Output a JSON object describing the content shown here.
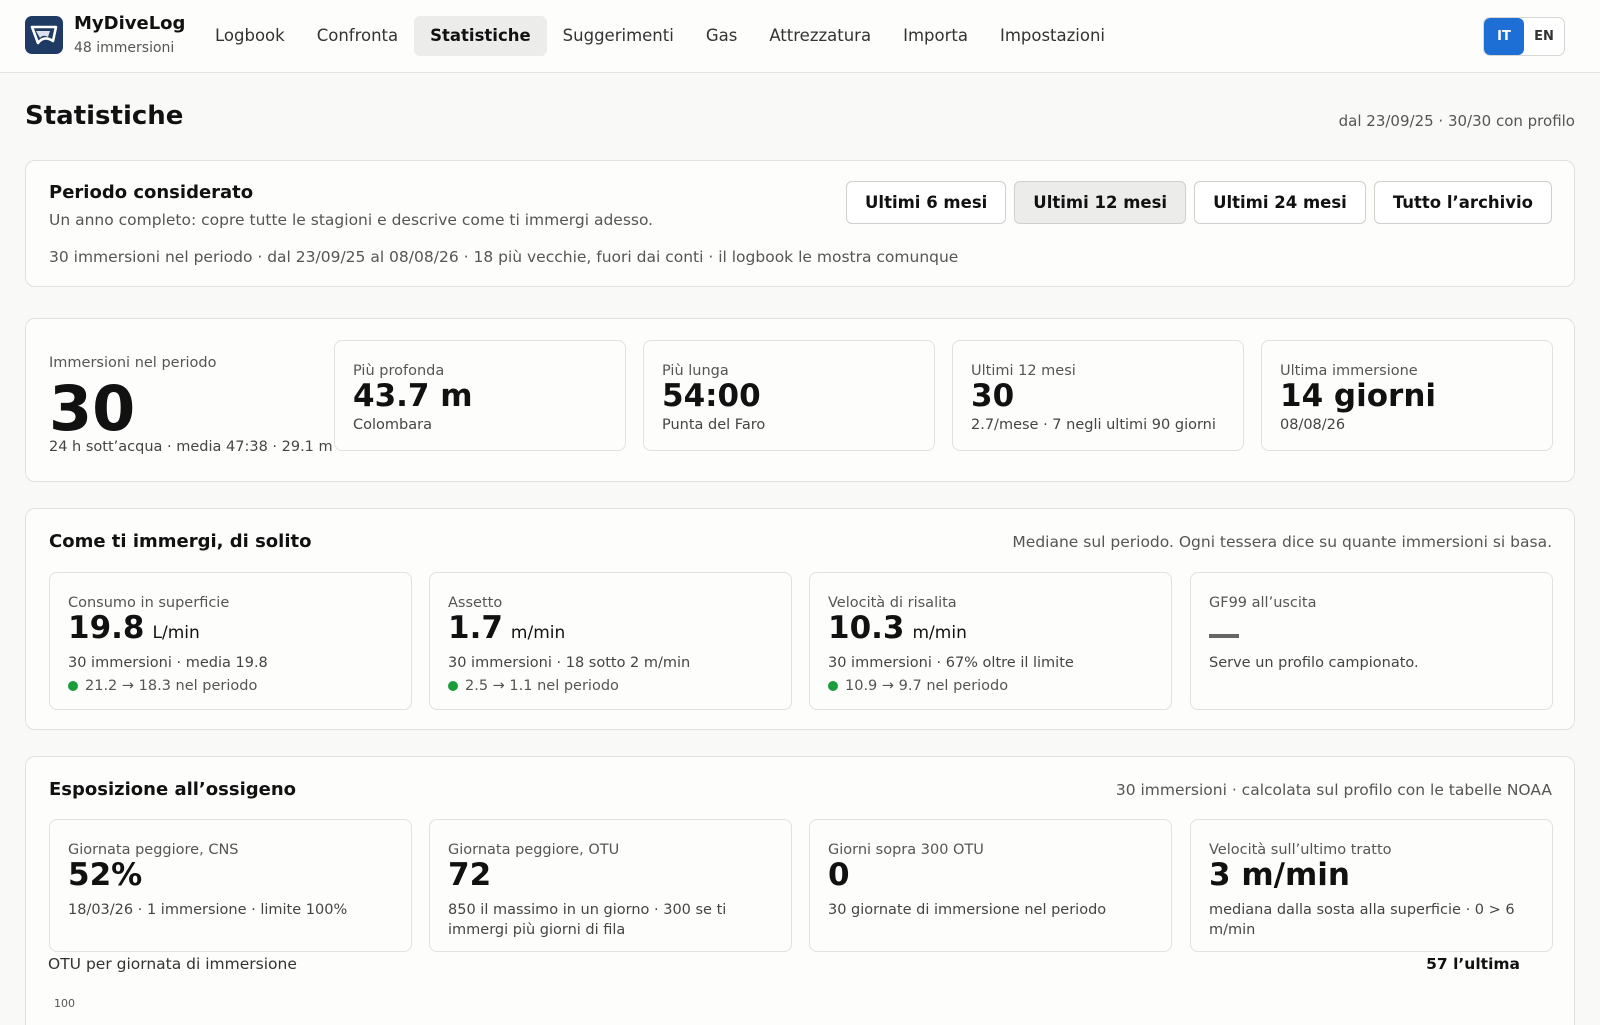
{
  "header": {
    "brand": "MyDiveLog",
    "dive_count": "48 immersioni",
    "nav": [
      "Logbook",
      "Confronta",
      "Statistiche",
      "Suggerimenti",
      "Gas",
      "Attrezzatura",
      "Importa",
      "Impostazioni"
    ],
    "active_nav": "Statistiche",
    "languages": [
      "IT",
      "EN"
    ],
    "active_language": "IT",
    "accent_color": "#1d6fd6"
  },
  "page": {
    "title": "Statistiche",
    "meta": "dal 23/09/25 · 30/30 con profilo"
  },
  "period": {
    "title": "Periodo considerato",
    "description": "Un anno completo: copre tutte le stagioni e descrive come ti immergi adesso.",
    "note": "30 immersioni nel periodo · dal 23/09/25 al 08/08/26 · 18 più vecchie, fuori dai conti · il logbook le mostra comunque",
    "options": [
      "Ultimi 6 mesi",
      "Ultimi 12 mesi",
      "Ultimi 24 mesi",
      "Tutto l’archivio"
    ],
    "selected": "Ultimi 12 mesi"
  },
  "summary": {
    "main_label": "Immersioni nel periodo",
    "main_value": "30",
    "main_sub": "24 h sott’acqua · media 47:38 · 29.1 m",
    "tiles": [
      {
        "label": "Più profonda",
        "value": "43.7 m",
        "sub": "Colombara"
      },
      {
        "label": "Più lunga",
        "value": "54:00",
        "sub": "Punta del Faro"
      },
      {
        "label": "Ultimi 12 mesi",
        "value": "30",
        "sub": "2.7/mese · 7 negli ultimi 90 giorni"
      },
      {
        "label": "Ultima immersione",
        "value": "14 giorni",
        "sub": "08/08/26"
      }
    ]
  },
  "habits": {
    "title": "Come ti immergi, di solito",
    "note": "Mediane sul periodo. Ogni tessera dice su quante immersioni si basa.",
    "tiles": [
      {
        "label": "Consumo in superficie",
        "value": "19.8",
        "unit": "L/min",
        "sub": "30 immersioni · media 19.8",
        "trend": "21.2 → 18.3 nel periodo",
        "trend_color": "#1a9e3a"
      },
      {
        "label": "Assetto",
        "value": "1.7",
        "unit": "m/min",
        "sub": "30 immersioni · 18 sotto 2 m/min",
        "trend": "2.5 → 1.1 nel periodo",
        "trend_color": "#1a9e3a"
      },
      {
        "label": "Velocità di risalita",
        "value": "10.3",
        "unit": "m/min",
        "sub": "30 immersioni · 67% oltre il limite",
        "trend": "10.9 → 9.7 nel periodo",
        "trend_color": "#1a9e3a"
      },
      {
        "label": "GF99 all’uscita",
        "value": "",
        "unit": "",
        "sub": "Serve un profilo campionato.",
        "trend": "",
        "trend_color": ""
      }
    ]
  },
  "oxygen": {
    "title": "Esposizione all’ossigeno",
    "note": "30 immersioni · calcolata sul profilo con le tabelle NOAA",
    "tiles": [
      {
        "label": "Giornata peggiore, CNS",
        "value": "52%",
        "sub": "18/03/26 · 1 immersione · limite 100%"
      },
      {
        "label": "Giornata peggiore, OTU",
        "value": "72",
        "sub": "850 il massimo in un giorno · 300 se ti immergi più giorni di fila"
      },
      {
        "label": "Giorni sopra 300 OTU",
        "value": "0",
        "sub": "30 giornate di immersione nel periodo"
      },
      {
        "label": "Velocità sull’ultimo tratto",
        "value": "3 m/min",
        "sub": "mediana dalla sosta alla superficie · 0 > 6 m/min"
      }
    ],
    "chart_label": "OTU per giornata di immersione",
    "chart_last": "57 l’ultima",
    "chart_top_tick": "100"
  }
}
